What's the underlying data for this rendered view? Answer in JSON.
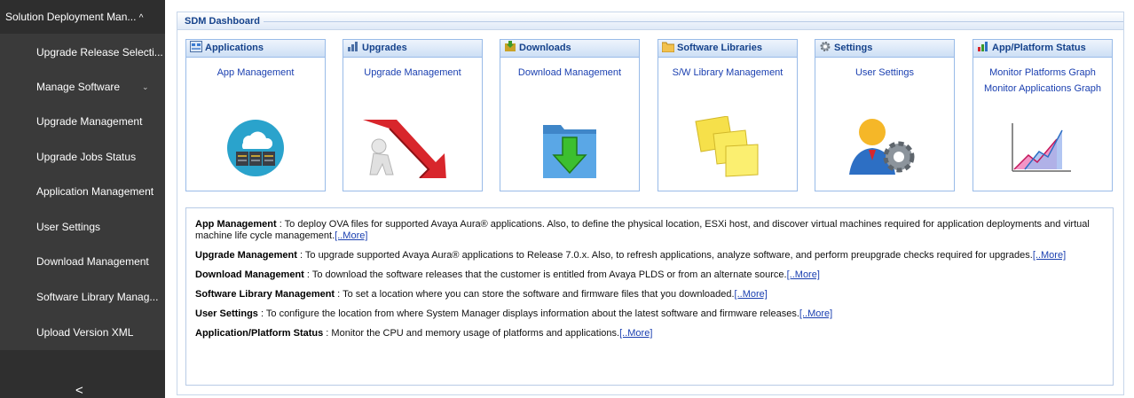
{
  "sidebar": {
    "title": "Solution Deployment Man...",
    "title_icon": "chevron-up-icon",
    "items": [
      {
        "label": "Upgrade Release Selecti..."
      },
      {
        "label": "Manage Software",
        "icon": "chevron-down-icon"
      },
      {
        "label": "Upgrade Management"
      },
      {
        "label": "Upgrade Jobs Status"
      },
      {
        "label": "Application Management"
      },
      {
        "label": "User Settings"
      },
      {
        "label": "Download Management"
      },
      {
        "label": "Software Library Manag..."
      },
      {
        "label": "Upload Version XML"
      }
    ],
    "collapse_glyph": "<",
    "collapse_icon": "chevron-left-icon"
  },
  "dashboard": {
    "title": "SDM Dashboard",
    "colors": {
      "header_text": "#15428b",
      "link": "#1a3fb0",
      "panel_border": "#99bbe8",
      "sidebar_bg": "#3a3a3a"
    },
    "panels": [
      {
        "title": "Applications",
        "icon": "applications-icon",
        "links": [
          "App Management"
        ],
        "art": "cloud-server-icon"
      },
      {
        "title": "Upgrades",
        "icon": "upgrades-icon",
        "links": [
          "Upgrade Management"
        ],
        "art": "upgrade-arrow-person-icon"
      },
      {
        "title": "Downloads",
        "icon": "downloads-icon",
        "links": [
          "Download Management"
        ],
        "art": "download-folder-icon"
      },
      {
        "title": "Software Libraries",
        "icon": "folder-icon",
        "links": [
          "S/W Library Management"
        ],
        "art": "sticky-notes-icon"
      },
      {
        "title": "Settings",
        "icon": "gear-icon",
        "links": [
          "User Settings"
        ],
        "art": "user-settings-icon"
      },
      {
        "title": "App/Platform Status",
        "icon": "status-icon",
        "links": [
          "Monitor Platforms Graph",
          "Monitor Applications Graph"
        ],
        "art": "graph-icon"
      }
    ]
  },
  "descriptions": [
    {
      "title": "App Management",
      "text": " : To deploy OVA files for supported Avaya Aura® applications. Also, to define the physical location, ESXi host, and discover virtual machines required for application deployments and virtual machine life cycle management.",
      "more": "[..More]"
    },
    {
      "title": "Upgrade Management",
      "text": " : To upgrade supported Avaya Aura® applications to Release 7.0.x. Also, to refresh applications, analyze software, and perform preupgrade checks required for upgrades.",
      "more": "[..More]"
    },
    {
      "title": "Download Management",
      "text": " : To download the software releases that the customer is entitled from Avaya PLDS or from an alternate source.",
      "more": "[..More]"
    },
    {
      "title": "Software Library Management",
      "text": " : To set a location where you can store the software and firmware files that you downloaded.",
      "more": "[..More]"
    },
    {
      "title": "User Settings",
      "text": " : To configure the location from where System Manager displays information about the latest software and firmware releases.",
      "more": "[..More]"
    },
    {
      "title": "Application/Platform Status",
      "text": " : Monitor the CPU and memory usage of platforms and applications.",
      "more": "[..More]"
    }
  ]
}
